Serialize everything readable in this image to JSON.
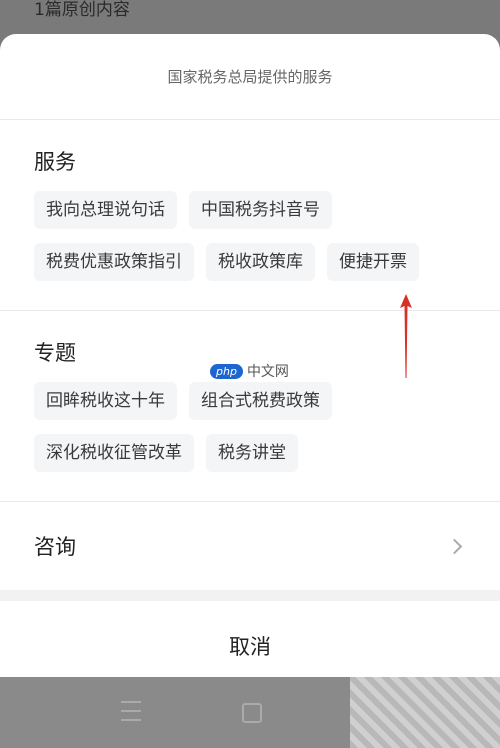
{
  "backdrop": {
    "line1": "1篇原创内容",
    "line2": "…"
  },
  "sheet": {
    "header": "国家税务总局提供的服务",
    "services": {
      "title": "服务",
      "chips": [
        "我向总理说句话",
        "中国税务抖音号",
        "税费优惠政策指引",
        "税收政策库",
        "便捷开票"
      ]
    },
    "topics": {
      "title": "专题",
      "chips": [
        "回眸税收这十年",
        "组合式税费政策",
        "深化税收征管改革",
        "税务讲堂"
      ]
    },
    "consult": "咨询",
    "cancel": "取消"
  },
  "annotation": {
    "color": "#d93025"
  },
  "watermark": {
    "badge": "php",
    "text": "中文网"
  }
}
